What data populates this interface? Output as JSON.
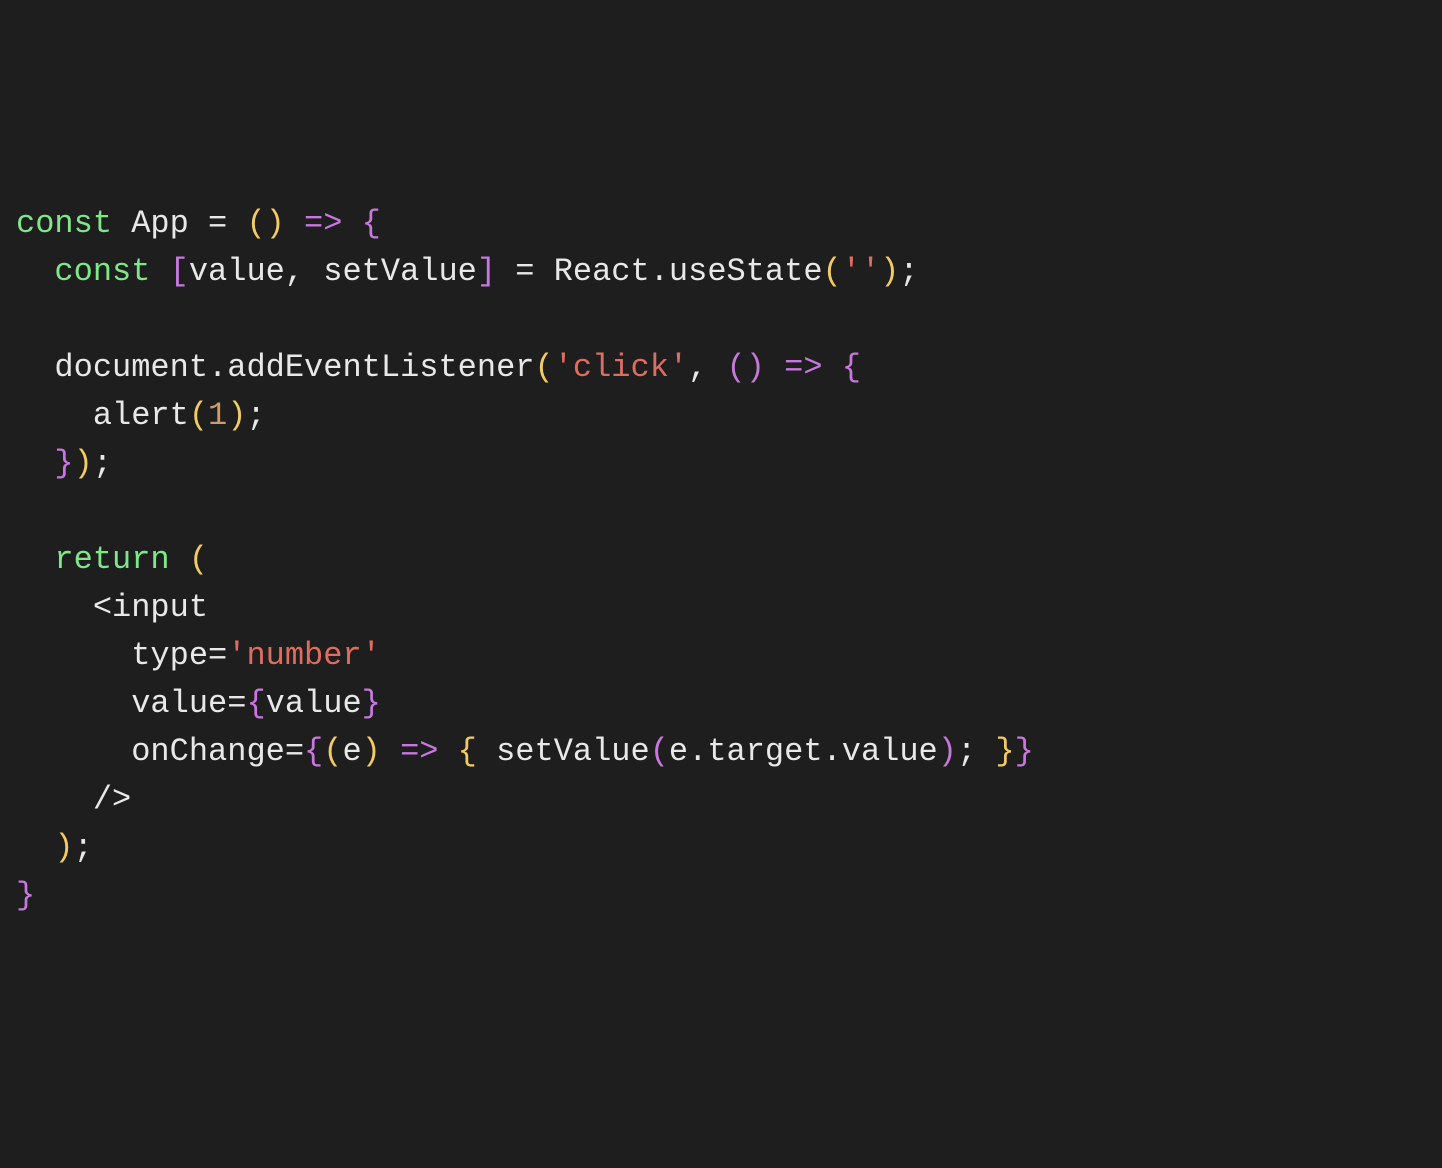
{
  "code": {
    "line1": {
      "const": "const",
      "app": " App ",
      "eq": "= ",
      "lparen1": "(",
      "rparen1": ")",
      "arrow": " => ",
      "lbrace1": "{"
    },
    "line2": {
      "indent": "  ",
      "const": "const",
      "space": " ",
      "lbracket": "[",
      "value": "value",
      "comma": ", ",
      "setValue": "setValue",
      "rbracket": "]",
      "eq": " = ",
      "react": "React",
      "dot": ".",
      "useState": "useState",
      "lparen": "(",
      "str": "''",
      "rparen": ")",
      "semi": ";"
    },
    "line3": {
      "empty": ""
    },
    "line4": {
      "indent": "  ",
      "document": "document",
      "dot": ".",
      "addEventListener": "addEventListener",
      "lparen1": "(",
      "str": "'click'",
      "comma": ", ",
      "lparen2": "(",
      "rparen2": ")",
      "arrow": " => ",
      "lbrace": "{"
    },
    "line5": {
      "indent": "    ",
      "alert": "alert",
      "lparen": "(",
      "num": "1",
      "rparen": ")",
      "semi": ";"
    },
    "line6": {
      "indent": "  ",
      "rbrace": "}",
      "rparen": ")",
      "semi": ";"
    },
    "line7": {
      "empty": ""
    },
    "line8": {
      "indent": "  ",
      "return": "return",
      "space": " ",
      "lparen": "("
    },
    "line9": {
      "indent": "    ",
      "lt": "<",
      "input": "input"
    },
    "line10": {
      "indent": "      ",
      "type": "type",
      "eq": "=",
      "str": "'number'"
    },
    "line11": {
      "indent": "      ",
      "value": "value",
      "eq": "=",
      "lbrace": "{",
      "valueVar": "value",
      "rbrace": "}"
    },
    "line12": {
      "indent": "      ",
      "onChange": "onChange",
      "eq": "=",
      "lbrace1": "{",
      "lparen1": "(",
      "e": "e",
      "rparen1": ")",
      "arrow": " => ",
      "lbrace2": "{",
      "space": " ",
      "setValue": "setValue",
      "lparen2": "(",
      "e2": "e",
      "dot1": ".",
      "target": "target",
      "dot2": ".",
      "valueProp": "value",
      "rparen2": ")",
      "semi": ";",
      "space2": " ",
      "rbrace2": "}",
      "rbrace1": "}"
    },
    "line13": {
      "indent": "    ",
      "close": "/>"
    },
    "line14": {
      "indent": "  ",
      "rparen": ")",
      "semi": ";"
    },
    "line15": {
      "rbrace": "}"
    }
  }
}
